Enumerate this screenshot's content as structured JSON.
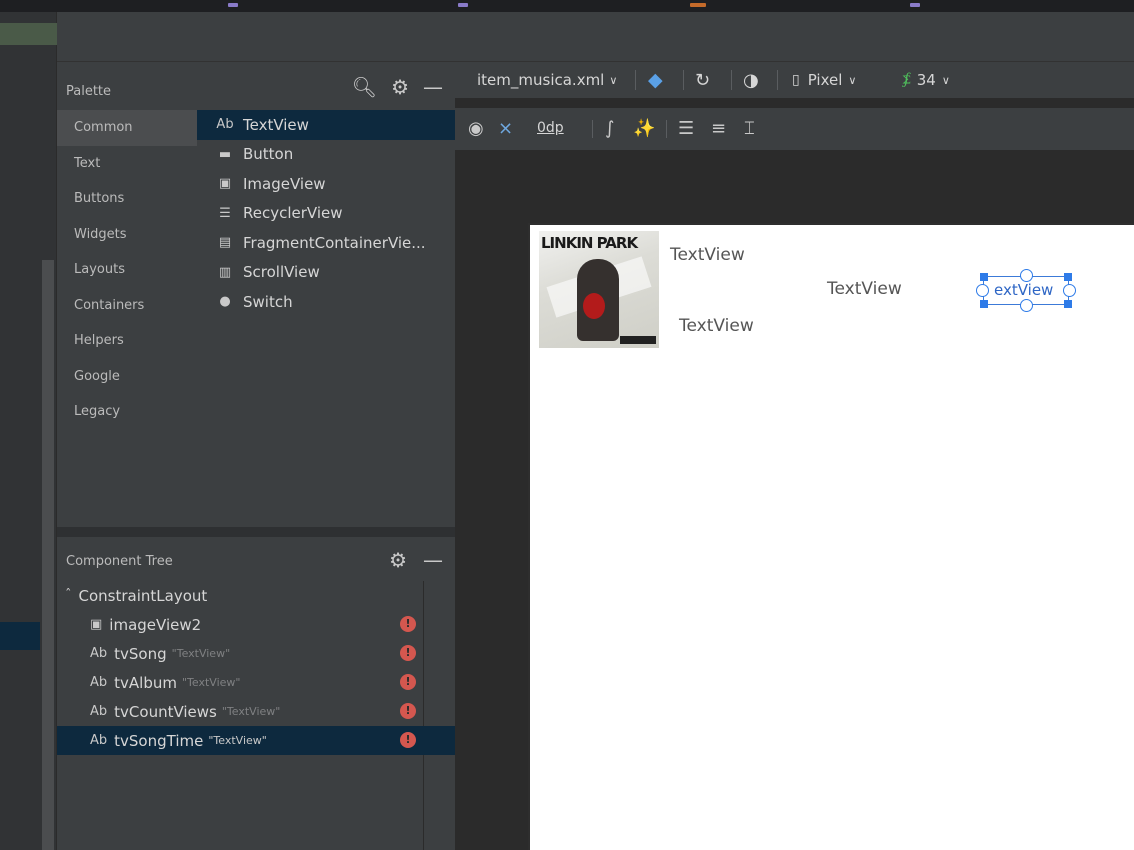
{
  "palette": {
    "title": "Palette",
    "categories": [
      "Common",
      "Text",
      "Buttons",
      "Widgets",
      "Layouts",
      "Containers",
      "Helpers",
      "Google",
      "Legacy"
    ],
    "items": [
      {
        "icon_text": "Ab",
        "label": "TextView"
      },
      {
        "icon": "button-icon",
        "label": "Button"
      },
      {
        "icon": "image-icon",
        "label": "ImageView"
      },
      {
        "icon": "list-icon",
        "label": "RecyclerView"
      },
      {
        "icon": "fragment-icon",
        "label": "FragmentContainerVie..."
      },
      {
        "icon": "scroll-icon",
        "label": "ScrollView"
      },
      {
        "icon": "switch-icon",
        "label": "Switch"
      }
    ]
  },
  "tree": {
    "title": "Component Tree",
    "rows": [
      {
        "label": "ConstraintLayout",
        "sub": "",
        "icon": "constraint-icon"
      },
      {
        "label": "imageView2",
        "sub": "",
        "icon": "image-icon",
        "error": "!"
      },
      {
        "icon_text": "Ab",
        "label": "tvSong",
        "sub": "\"TextView\"",
        "error": "!"
      },
      {
        "icon_text": "Ab",
        "label": "tvAlbum",
        "sub": "\"TextView\"",
        "error": "!"
      },
      {
        "icon_text": "Ab",
        "label": "tvCountViews",
        "sub": "\"TextView\"",
        "error": "!"
      },
      {
        "icon_text": "Ab",
        "label": "tvSongTime",
        "sub": "\"TextView\"",
        "error": "!"
      }
    ]
  },
  "toolbar": {
    "file": "item_musica.xml",
    "device": "Pixel",
    "api": "34",
    "margin": "0dp"
  },
  "design": {
    "cover_text": "LINKIN PARK",
    "tv1": "TextView",
    "tv2": "TextView",
    "tv3": "TextView",
    "selected_text": "extView"
  },
  "colors": {
    "error": "#d4574f",
    "selection": "#0d293e",
    "handle": "#2e7be8"
  }
}
